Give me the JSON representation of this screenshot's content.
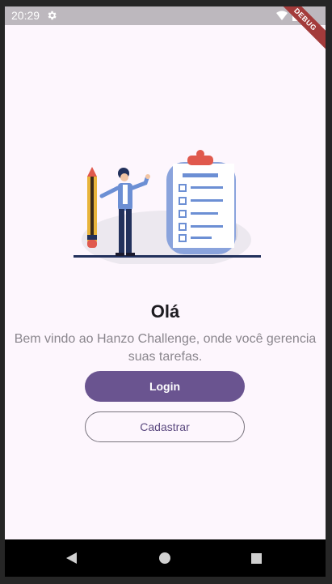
{
  "status_bar": {
    "time": "20:29",
    "debug_label": "DEBUG"
  },
  "main": {
    "greeting": "Olá",
    "subtitle": "Bem vindo ao Hanzo Challenge, onde você gerencia suas tarefas.",
    "login_label": "Login",
    "signup_label": "Cadastrar"
  },
  "nav_bar": {
    "icons": [
      "back-icon",
      "home-icon",
      "recents-icon"
    ]
  },
  "colors": {
    "background": "#fdf6fd",
    "primary": "#6a5490",
    "status_bar": "#bdb8be",
    "debug_banner": "#a33b3b"
  }
}
